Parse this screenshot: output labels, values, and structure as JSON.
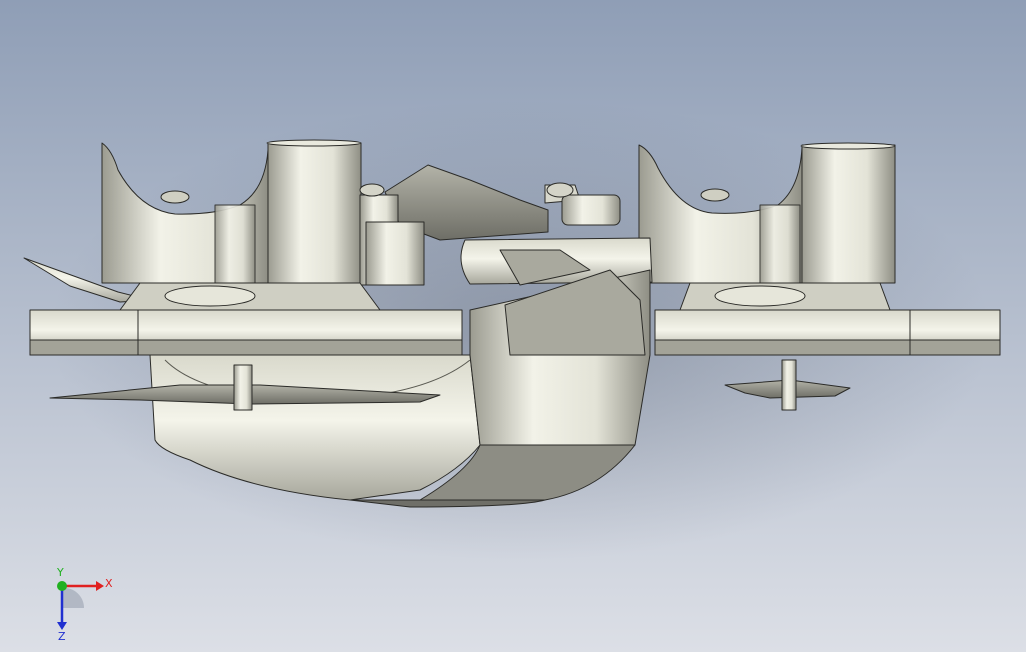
{
  "viewport": {
    "background_top": "#8f9eb6",
    "background_bottom": "#dcdfe6",
    "model_name": "",
    "model_colors": {
      "light": "#f1f1e6",
      "mid": "#c9c9bc",
      "dark": "#8a8a80",
      "edge": "#2b2b28"
    }
  },
  "triad": {
    "x_label": "X",
    "y_label": "Y",
    "z_label": "Z",
    "x_color": "#e02020",
    "y_color": "#20b020",
    "z_color": "#2030d0"
  }
}
